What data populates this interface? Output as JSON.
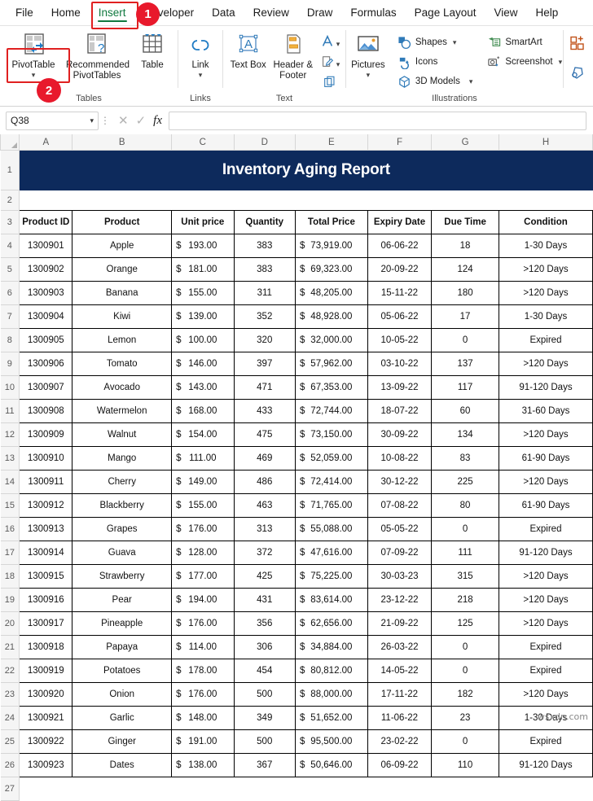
{
  "ribbon": {
    "tabs": [
      {
        "label": "File",
        "active": false
      },
      {
        "label": "Home",
        "active": false
      },
      {
        "label": "Insert",
        "active": true
      },
      {
        "label": "Developer",
        "active": false
      },
      {
        "label": "Data",
        "active": false
      },
      {
        "label": "Review",
        "active": false
      },
      {
        "label": "Draw",
        "active": false
      },
      {
        "label": "Formulas",
        "active": false
      },
      {
        "label": "Page Layout",
        "active": false
      },
      {
        "label": "View",
        "active": false
      },
      {
        "label": "Help",
        "active": false
      }
    ],
    "groups": {
      "tables": {
        "label": "Tables",
        "pivottable": "PivotTable",
        "recommended_pivottables": "Recommended PivotTables",
        "table": "Table"
      },
      "links": {
        "label": "Links",
        "link": "Link"
      },
      "text": {
        "label": "Text",
        "text_box": "Text Box",
        "header_footer": "Header & Footer",
        "wordart": "WordArt",
        "signature_line": "Signature Line",
        "object": "Object"
      },
      "illustrations": {
        "label": "Illustrations",
        "pictures": "Pictures",
        "shapes": "Shapes",
        "icons": "Icons",
        "models_3d": "3D Models",
        "smartart": "SmartArt",
        "screenshot": "Screenshot"
      },
      "addins": {
        "get_addins": "Get Add-ins",
        "my_addins": "My Add-ins"
      }
    },
    "callouts": [
      {
        "number": "1",
        "target": "insert-tab"
      },
      {
        "number": "2",
        "target": "pivottable-button"
      }
    ]
  },
  "formula_bar": {
    "name_box_value": "Q38",
    "formula_value": "",
    "cancel_icon": "close-icon",
    "enter_icon": "check-icon",
    "function_icon": "fx"
  },
  "sheet": {
    "column_headers": [
      "A",
      "B",
      "C",
      "D",
      "E",
      "F",
      "G",
      "H"
    ],
    "row_numbers": [
      "1",
      "2",
      "3",
      "4",
      "5",
      "6",
      "7",
      "8",
      "9",
      "10",
      "11",
      "12",
      "13",
      "14",
      "15",
      "16",
      "17",
      "18",
      "19",
      "20",
      "21",
      "22",
      "23",
      "24",
      "25",
      "26",
      "27"
    ],
    "title": "Inventory Aging Report",
    "title_bg": "#0d2a5c",
    "header_bg": "#8fa8c4",
    "table_headers": [
      "Product ID",
      "Product",
      "Unit price",
      "Quantity",
      "Total Price",
      "Expiry Date",
      "Due Time",
      "Condition"
    ],
    "rows": [
      {
        "product_id": "1300901",
        "product": "Apple",
        "unit_price": "193.00",
        "quantity": "383",
        "total_price": "73,919.00",
        "expiry_date": "06-06-22",
        "due_time": "18",
        "condition": "1-30 Days"
      },
      {
        "product_id": "1300902",
        "product": "Orange",
        "unit_price": "181.00",
        "quantity": "383",
        "total_price": "69,323.00",
        "expiry_date": "20-09-22",
        "due_time": "124",
        "condition": ">120 Days"
      },
      {
        "product_id": "1300903",
        "product": "Banana",
        "unit_price": "155.00",
        "quantity": "311",
        "total_price": "48,205.00",
        "expiry_date": "15-11-22",
        "due_time": "180",
        "condition": ">120 Days"
      },
      {
        "product_id": "1300904",
        "product": "Kiwi",
        "unit_price": "139.00",
        "quantity": "352",
        "total_price": "48,928.00",
        "expiry_date": "05-06-22",
        "due_time": "17",
        "condition": "1-30 Days"
      },
      {
        "product_id": "1300905",
        "product": "Lemon",
        "unit_price": "100.00",
        "quantity": "320",
        "total_price": "32,000.00",
        "expiry_date": "10-05-22",
        "due_time": "0",
        "condition": "Expired"
      },
      {
        "product_id": "1300906",
        "product": "Tomato",
        "unit_price": "146.00",
        "quantity": "397",
        "total_price": "57,962.00",
        "expiry_date": "03-10-22",
        "due_time": "137",
        "condition": ">120 Days"
      },
      {
        "product_id": "1300907",
        "product": "Avocado",
        "unit_price": "143.00",
        "quantity": "471",
        "total_price": "67,353.00",
        "expiry_date": "13-09-22",
        "due_time": "117",
        "condition": "91-120 Days"
      },
      {
        "product_id": "1300908",
        "product": "Watermelon",
        "unit_price": "168.00",
        "quantity": "433",
        "total_price": "72,744.00",
        "expiry_date": "18-07-22",
        "due_time": "60",
        "condition": "31-60 Days"
      },
      {
        "product_id": "1300909",
        "product": "Walnut",
        "unit_price": "154.00",
        "quantity": "475",
        "total_price": "73,150.00",
        "expiry_date": "30-09-22",
        "due_time": "134",
        "condition": ">120 Days"
      },
      {
        "product_id": "1300910",
        "product": "Mango",
        "unit_price": "111.00",
        "quantity": "469",
        "total_price": "52,059.00",
        "expiry_date": "10-08-22",
        "due_time": "83",
        "condition": "61-90 Days"
      },
      {
        "product_id": "1300911",
        "product": "Cherry",
        "unit_price": "149.00",
        "quantity": "486",
        "total_price": "72,414.00",
        "expiry_date": "30-12-22",
        "due_time": "225",
        "condition": ">120 Days"
      },
      {
        "product_id": "1300912",
        "product": "Blackberry",
        "unit_price": "155.00",
        "quantity": "463",
        "total_price": "71,765.00",
        "expiry_date": "07-08-22",
        "due_time": "80",
        "condition": "61-90 Days"
      },
      {
        "product_id": "1300913",
        "product": "Grapes",
        "unit_price": "176.00",
        "quantity": "313",
        "total_price": "55,088.00",
        "expiry_date": "05-05-22",
        "due_time": "0",
        "condition": "Expired"
      },
      {
        "product_id": "1300914",
        "product": "Guava",
        "unit_price": "128.00",
        "quantity": "372",
        "total_price": "47,616.00",
        "expiry_date": "07-09-22",
        "due_time": "111",
        "condition": "91-120 Days"
      },
      {
        "product_id": "1300915",
        "product": "Strawberry",
        "unit_price": "177.00",
        "quantity": "425",
        "total_price": "75,225.00",
        "expiry_date": "30-03-23",
        "due_time": "315",
        "condition": ">120 Days"
      },
      {
        "product_id": "1300916",
        "product": "Pear",
        "unit_price": "194.00",
        "quantity": "431",
        "total_price": "83,614.00",
        "expiry_date": "23-12-22",
        "due_time": "218",
        "condition": ">120 Days"
      },
      {
        "product_id": "1300917",
        "product": "Pineapple",
        "unit_price": "176.00",
        "quantity": "356",
        "total_price": "62,656.00",
        "expiry_date": "21-09-22",
        "due_time": "125",
        "condition": ">120 Days"
      },
      {
        "product_id": "1300918",
        "product": "Papaya",
        "unit_price": "114.00",
        "quantity": "306",
        "total_price": "34,884.00",
        "expiry_date": "26-03-22",
        "due_time": "0",
        "condition": "Expired"
      },
      {
        "product_id": "1300919",
        "product": "Potatoes",
        "unit_price": "178.00",
        "quantity": "454",
        "total_price": "80,812.00",
        "expiry_date": "14-05-22",
        "due_time": "0",
        "condition": "Expired"
      },
      {
        "product_id": "1300920",
        "product": "Onion",
        "unit_price": "176.00",
        "quantity": "500",
        "total_price": "88,000.00",
        "expiry_date": "17-11-22",
        "due_time": "182",
        "condition": ">120 Days"
      },
      {
        "product_id": "1300921",
        "product": "Garlic",
        "unit_price": "148.00",
        "quantity": "349",
        "total_price": "51,652.00",
        "expiry_date": "11-06-22",
        "due_time": "23",
        "condition": "1-30 Days"
      },
      {
        "product_id": "1300922",
        "product": "Ginger",
        "unit_price": "191.00",
        "quantity": "500",
        "total_price": "95,500.00",
        "expiry_date": "23-02-22",
        "due_time": "0",
        "condition": "Expired"
      },
      {
        "product_id": "1300923",
        "product": "Dates",
        "unit_price": "138.00",
        "quantity": "367",
        "total_price": "50,646.00",
        "expiry_date": "06-09-22",
        "due_time": "110",
        "condition": "91-120 Days"
      }
    ],
    "currency_symbol": "$"
  },
  "watermark": "wsxdn.com"
}
